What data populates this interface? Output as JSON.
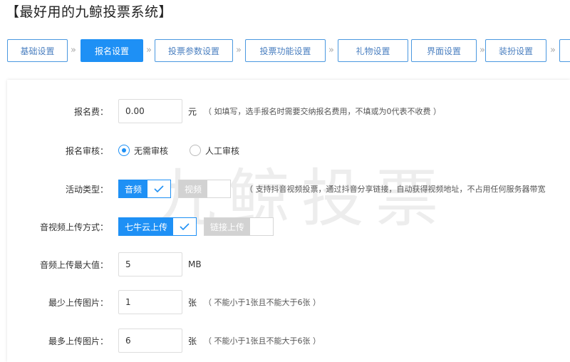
{
  "page": {
    "title": "【最好用的九鲸投票系统】"
  },
  "steps": [
    {
      "label": "基础设置",
      "active": false
    },
    {
      "label": "报名设置",
      "active": true
    },
    {
      "label": "投票参数设置",
      "active": false
    },
    {
      "label": "投票功能设置",
      "active": false
    },
    {
      "label": "礼物设置",
      "active": false
    },
    {
      "label": "界面设置",
      "active": false
    },
    {
      "label": "装扮设置",
      "active": false
    }
  ],
  "watermark": "九鲸投票",
  "form": {
    "fee": {
      "label": "报名费：",
      "value": "0.00",
      "unit": "元",
      "hint": "（ 如填写，选手报名时需要交纳报名费用，不填或为0代表不收费 ）"
    },
    "review": {
      "label": "报名审核：",
      "options": [
        "无需审核",
        "人工审核"
      ],
      "selected": "无需审核"
    },
    "activity_type": {
      "label": "活动类型：",
      "options": [
        {
          "text": "音频",
          "checked": true
        },
        {
          "text": "视频",
          "checked": false
        }
      ],
      "hint": "（ 支持抖音视频投票，通过抖音分享链接，自动获得视频地址，不占用任何服务器带宽"
    },
    "upload_method": {
      "label": "音视频上传方式：",
      "options": [
        {
          "text": "七牛云上传",
          "checked": true
        },
        {
          "text": "链接上传",
          "checked": false
        }
      ]
    },
    "audio_max": {
      "label": "音频上传最大值：",
      "value": "5",
      "unit": "MB"
    },
    "min_images": {
      "label": "最少上传图片：",
      "value": "1",
      "unit": "张",
      "hint": "（ 不能小于1张且不能大于6张 ）"
    },
    "max_images": {
      "label": "最多上传图片：",
      "value": "6",
      "unit": "张",
      "hint": "（ 不能小于1张且不能大于6张 ）"
    }
  },
  "colors": {
    "accent": "#1e90f5",
    "step_border": "#4a98e0",
    "inactive_toggle": "#d2d2d2"
  }
}
